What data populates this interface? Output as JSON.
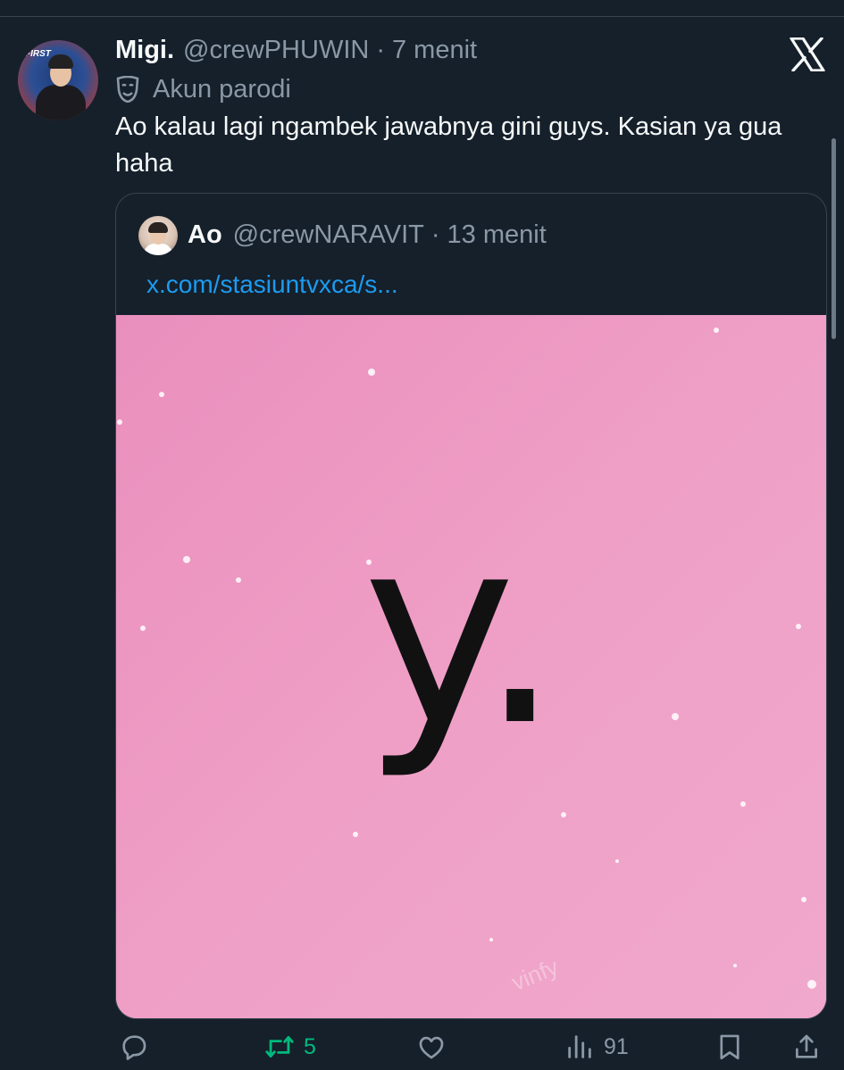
{
  "tweet": {
    "display_name": "Migi.",
    "handle": "@crewPHUWIN",
    "separator": "·",
    "time": "7 menit",
    "label": "Akun parodi",
    "text": "Ao kalau lagi ngambek jawabnya gini guys. Kasian ya gua haha",
    "avatar_text": "FIRST"
  },
  "quoted": {
    "display_name": "Ao",
    "handle": "@crewNARAVIT",
    "separator": "·",
    "time": "13 menit",
    "link": "x.com/stasiuntvxca/s...",
    "media": {
      "main_text": "y.",
      "watermark": "vinfy",
      "background": "#ec9bc2"
    }
  },
  "actions": {
    "reply_count": "",
    "retweet_count": "5",
    "like_count": "",
    "views_count": "91"
  },
  "colors": {
    "background": "#15202b",
    "text": "#f7f9f9",
    "muted": "#8b98a5",
    "link": "#1d9bf0",
    "retweet": "#00ba7c",
    "border": "#38444d"
  },
  "icons": [
    "x-logo-icon",
    "parody-mask-icon",
    "reply-icon",
    "retweet-icon",
    "like-icon",
    "views-icon",
    "bookmark-icon",
    "share-icon"
  ]
}
